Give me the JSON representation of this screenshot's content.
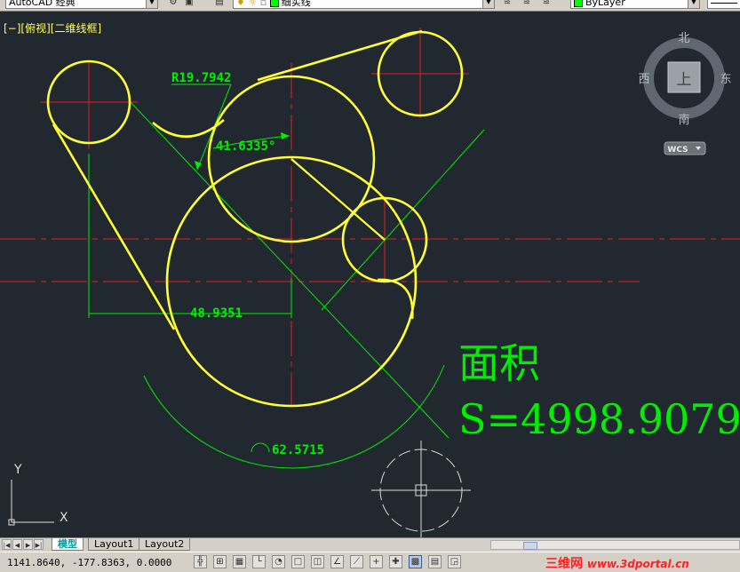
{
  "toolbar": {
    "workspace": "AutoCAD 经典",
    "layer_name": "细实线",
    "color": "ByLayer",
    "color_swatch": "#00ff00"
  },
  "viewport": {
    "label": "[−][俯视][二维线框]",
    "background": "#212830",
    "viewcube": {
      "north": "北",
      "south": "南",
      "west": "西",
      "east": "东",
      "top": "上",
      "wcs": "WCS"
    },
    "ucs": {
      "x": "X",
      "y": "Y"
    }
  },
  "dimensions": {
    "radius": "R19.7942",
    "angle1": "41.6335°",
    "linear": "48.9351",
    "angle2": "62.5715"
  },
  "area": {
    "title": "面积",
    "value": "S=4998.9079",
    "color": "#00ee00"
  },
  "tabs": {
    "model": "模型",
    "layout1": "Layout1",
    "layout2": "Layout2"
  },
  "status": {
    "coordinates": "1141.8640, -177.8363, 0.0000"
  },
  "watermark": {
    "text": "三维网",
    "url": "www.3dportal.cn"
  },
  "colors": {
    "geometry": "#ffff33",
    "centerline": "#e02020",
    "dimension": "#00ee00"
  }
}
